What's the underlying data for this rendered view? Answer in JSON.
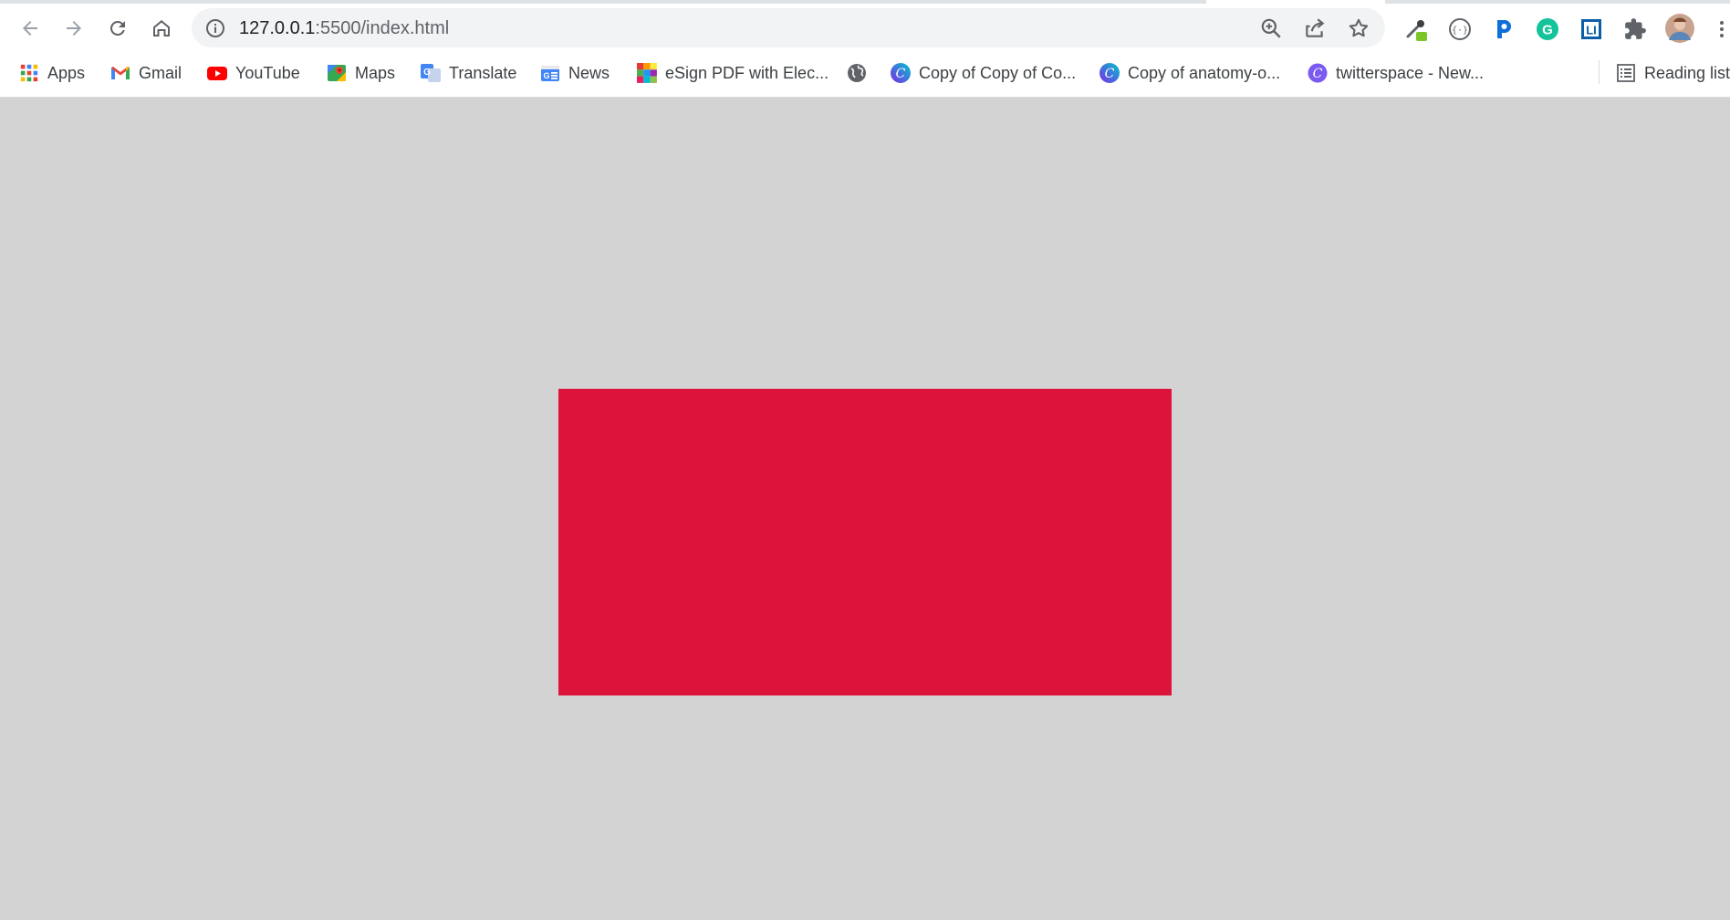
{
  "browser": {
    "url_host": "127.0.0.1",
    "url_path": ":5500/index.html"
  },
  "bookmarks": [
    {
      "label": "Apps",
      "icon": "apps-grid-icon"
    },
    {
      "label": "Gmail",
      "icon": "gmail-icon"
    },
    {
      "label": "YouTube",
      "icon": "youtube-icon"
    },
    {
      "label": "Maps",
      "icon": "maps-icon"
    },
    {
      "label": "Translate",
      "icon": "translate-icon"
    },
    {
      "label": "News",
      "icon": "news-icon"
    },
    {
      "label": "eSign PDF with Elec...",
      "icon": "esign-icon"
    },
    {
      "label": "",
      "icon": "globe-icon"
    },
    {
      "label": "Copy of Copy of Co...",
      "icon": "canva-icon"
    },
    {
      "label": "Copy of anatomy-o...",
      "icon": "canva-icon"
    },
    {
      "label": "twitterspace - New...",
      "icon": "canva-icon"
    }
  ],
  "reading_list": {
    "label": "Reading list",
    "icon": "reading-list-icon"
  },
  "page": {
    "background": "#d3d3d3",
    "box_color": "#dc143c"
  }
}
